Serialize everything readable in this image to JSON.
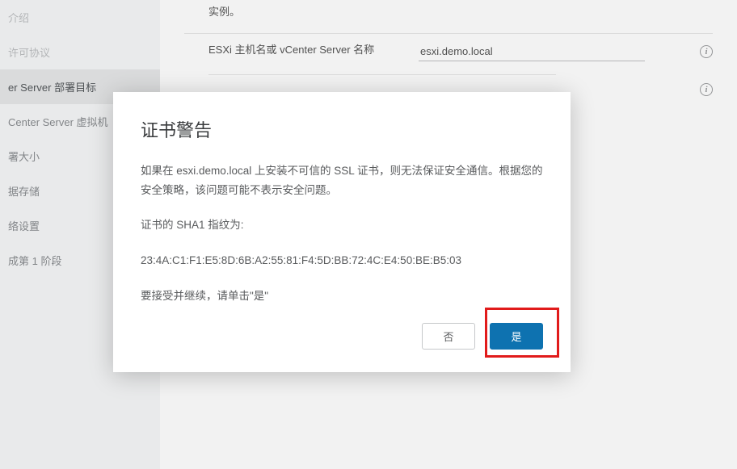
{
  "sidebar": {
    "items": [
      {
        "label": "介绍"
      },
      {
        "label": "许可协议"
      },
      {
        "label": "er Server 部署目标"
      },
      {
        "label": "Center Server 虚拟机"
      },
      {
        "label": "署大小"
      },
      {
        "label": "据存储"
      },
      {
        "label": "络设置"
      },
      {
        "label": "成第 1 阶段"
      }
    ]
  },
  "main": {
    "intro_tail": "实例。",
    "host_label": "ESXi 主机名或 vCenter Server 名称",
    "host_value": "esxi.demo.local"
  },
  "modal": {
    "title": "证书警告",
    "body1": "如果在 esxi.demo.local 上安装不可信的 SSL 证书，则无法保证安全通信。根据您的安全策略，该问题可能不表示安全问题。",
    "sha_label": "证书的 SHA1 指纹为:",
    "sha_value": "23:4A:C1:F1:E5:8D:6B:A2:55:81:F4:5D:BB:72:4C:E4:50:BE:B5:03",
    "accept_hint": "要接受并继续，请单击\"是\"",
    "no_label": "否",
    "yes_label": "是"
  }
}
